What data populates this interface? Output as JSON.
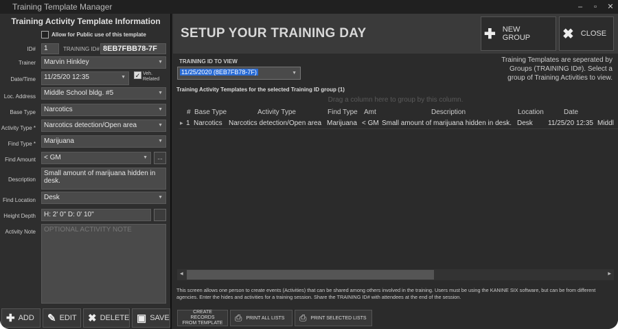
{
  "window": {
    "title": "Training Template Manager",
    "minimize": "–",
    "maximize": "▫",
    "close": "✕"
  },
  "left": {
    "title": "Training Activity Template Information",
    "public_label": "Allow for Public use of this template",
    "id_label": "ID#",
    "id_value": "1",
    "training_id_label": "TRAINING ID#",
    "training_id_value": "8EB7FBB78-7F",
    "trainer_label": "Trainer",
    "trainer_value": "Marvin Hinkley",
    "datetime_label": "Date/Time",
    "datetime_value": "11/25/20 12:35",
    "veh_label_1": "Veh.",
    "veh_label_2": "Related",
    "loc_label": "Loc. Address",
    "loc_value": "Middle School bldg. #5",
    "base_type_label": "Base Type",
    "base_type_value": "Narcotics",
    "activity_type_label": "Activity Type *",
    "activity_type_value": "Narcotics detection/Open area",
    "find_type_label": "Find Type *",
    "find_type_value": "Marijuana",
    "find_amount_label": "Find Amount",
    "find_amount_value": "< GM",
    "description_label": "Description",
    "description_value": "Small amount of marijuana hidden in desk.",
    "find_location_label": "Find Location",
    "find_location_value": "Desk",
    "height_depth_label": "Height Depth",
    "height_depth_value": "H: 2' 0\" D: 0' 10\"",
    "activity_note_label": "Activity Note",
    "activity_note_placeholder": "OPTIONAL ACTIVITY NOTE",
    "ellipsis": "...",
    "buttons": {
      "add": "ADD",
      "edit": "EDIT",
      "delete": "DELETE",
      "save": "SAVE"
    }
  },
  "right": {
    "header_title": "SETUP YOUR TRAINING DAY",
    "new_group": "NEW GROUP",
    "close": "CLOSE",
    "tid_view_label": "TRAINING ID TO VIEW",
    "tid_view_value": "11/25/2020 (8EB7FB78-7F)",
    "info_text": "Training Templates are seperated by Groups (TRAINING ID#). Select a group of Training Activities to view.",
    "grid_title": "Training Activity Templates for the selected Training ID group (1)",
    "drag_hint": "Drag a column here to group by this column.",
    "columns": [
      "#",
      "Base Type",
      "Activity Type",
      "Find Type",
      "Amt",
      "Description",
      "Location",
      "Date"
    ],
    "rows": [
      [
        "1",
        "Narcotics",
        "Narcotics detection/Open area",
        "Marijuana",
        "< GM",
        "Small amount of marijuana hidden in desk.",
        "Desk",
        "11/25/20 12:35",
        "Middl"
      ]
    ],
    "footer_text": "This screen allows one person to create events (Activities) that can be shared among others involved in the training. Users must be using the KANINE SIX software, but can be from different agencies. Enter the hides and activities for a training session. Share the TRAINING ID# with attendees at the end of the session.",
    "create_records_1": "CREATE RECORDS",
    "create_records_2": "FROM TEMPLATE",
    "print_all": "PRINT ALL LISTS",
    "print_selected": "PRINT SELECTED LISTS"
  }
}
